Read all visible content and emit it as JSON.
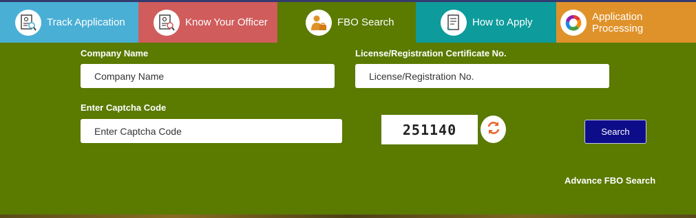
{
  "tabs": [
    {
      "label": "Track Application",
      "icon": "magnifier-document-icon"
    },
    {
      "label": "Know Your Officer",
      "icon": "officer-document-icon"
    },
    {
      "label": "FBO Search",
      "icon": "businessman-icon"
    },
    {
      "label": "How to Apply",
      "icon": "document-pen-icon"
    },
    {
      "label": "Application Processing",
      "icon": "color-cycle-icon"
    }
  ],
  "form": {
    "company_label": "Company Name",
    "company_placeholder": "Company Name",
    "license_label": "License/Registration Certificate No.",
    "license_placeholder": "License/Registration No.",
    "captcha_label": "Enter Captcha Code",
    "captcha_placeholder": "Enter Captcha Code",
    "captcha_code": "251140",
    "search_label": "Search",
    "advance_link": "Advance FBO Search"
  },
  "colors": {
    "panel_bg": "#5a7a00",
    "tab_track": "#4aafd5",
    "tab_officer": "#d05c5c",
    "tab_howto": "#0e9b9b",
    "tab_processing": "#e0922a",
    "search_button": "#0d0d8a",
    "refresh_icon": "#e8632b"
  }
}
